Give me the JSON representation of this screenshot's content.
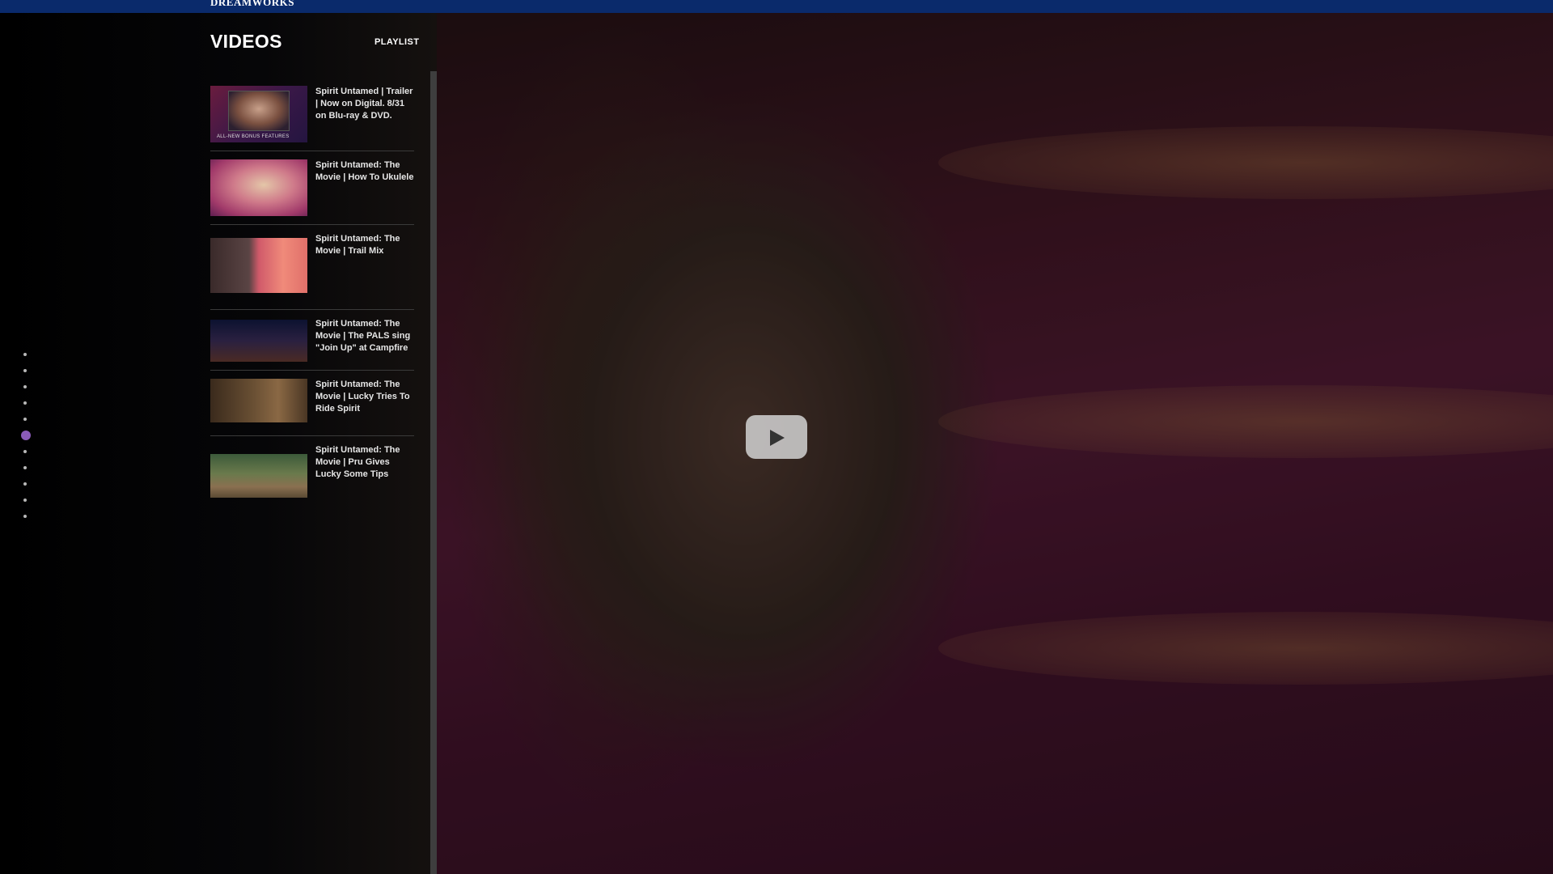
{
  "header": {
    "brand": "DREAMWORKS"
  },
  "videos_section": {
    "title": "VIDEOS",
    "playlist_label": "PLAYLIST",
    "items": [
      {
        "title": "Spirit Untamed | Trailer | Now on Digital. 8/31 on Blu-ray & DVD.",
        "thumb_caption": "ALL-NEW BONUS FEATURES"
      },
      {
        "title": "Spirit Untamed: The Movie | How To Ukulele"
      },
      {
        "title": "Spirit Untamed: The Movie | Trail Mix"
      },
      {
        "title": "Spirit Untamed: The Movie | The PALS sing \"Join Up\" at Campfire"
      },
      {
        "title": "Spirit Untamed: The Movie | Lucky Tries To Ride Spirit"
      },
      {
        "title": "Spirit Untamed: The Movie | Pru Gives Lucky Some Tips"
      }
    ]
  },
  "page_dots": {
    "count": 11,
    "active_index": 5,
    "active_color": "#8a5bb8"
  },
  "player": {
    "play_icon": "play-icon"
  },
  "colors": {
    "topbar": "#0a2a6b",
    "accent": "#8a5bb8"
  }
}
